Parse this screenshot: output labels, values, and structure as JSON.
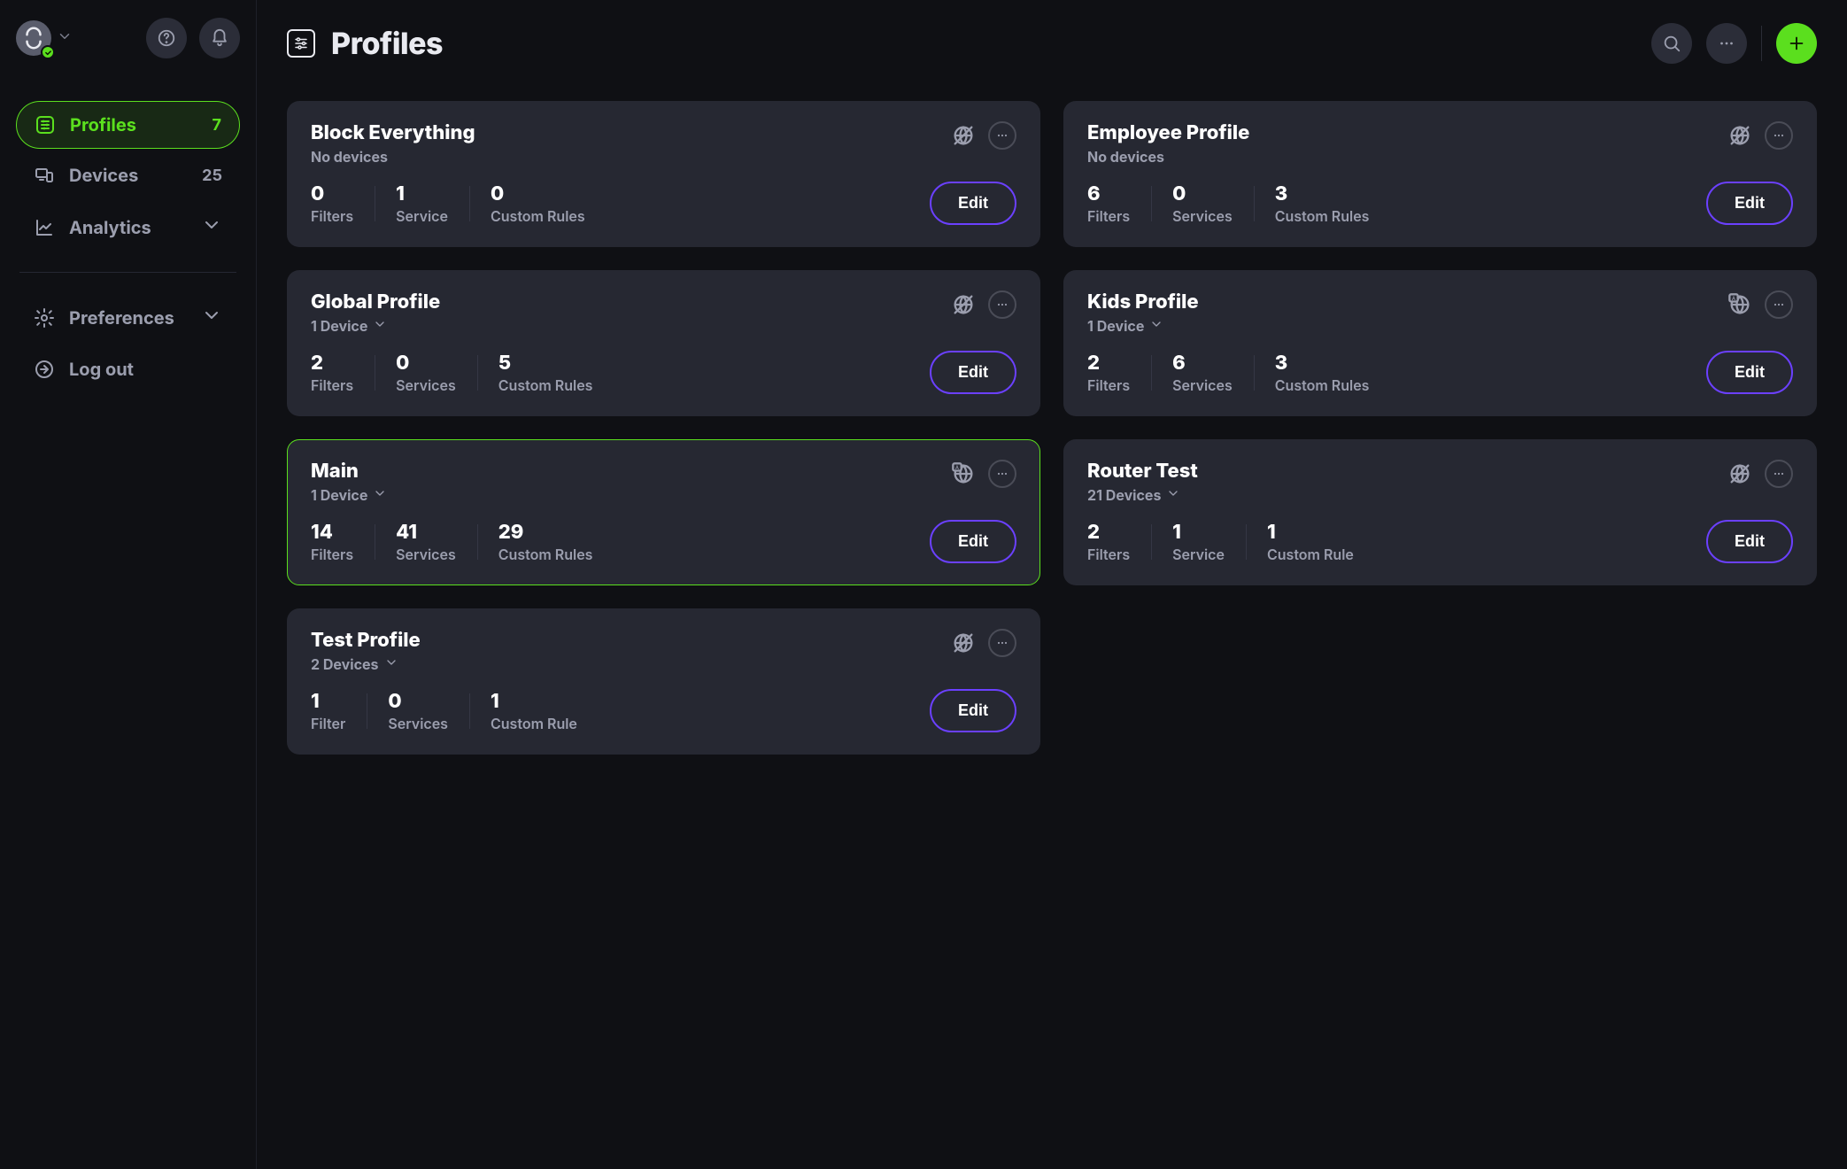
{
  "page_title": "Profiles",
  "sidebar": {
    "items": [
      {
        "icon": "sliders",
        "label": "Profiles",
        "count": "7",
        "active": true
      },
      {
        "icon": "devices",
        "label": "Devices",
        "count": "25"
      },
      {
        "icon": "analytics",
        "label": "Analytics",
        "chevron": true
      },
      {
        "divider": true
      },
      {
        "icon": "gear",
        "label": "Preferences",
        "chevron": true
      },
      {
        "icon": "logout",
        "label": "Log out"
      }
    ]
  },
  "cards": [
    {
      "title": "Block Everything",
      "sub": "No devices",
      "globe": "off",
      "stats": [
        {
          "n": "0",
          "l": "Filters"
        },
        {
          "n": "1",
          "l": "Service"
        },
        {
          "n": "0",
          "l": "Custom Rules"
        }
      ],
      "edit": "Edit"
    },
    {
      "title": "Employee Profile",
      "sub": "No devices",
      "globe": "off",
      "stats": [
        {
          "n": "6",
          "l": "Filters"
        },
        {
          "n": "0",
          "l": "Services"
        },
        {
          "n": "3",
          "l": "Custom Rules"
        }
      ],
      "edit": "Edit"
    },
    {
      "title": "Global Profile",
      "sub": "1 Device",
      "chev": true,
      "globe": "off",
      "stats": [
        {
          "n": "2",
          "l": "Filters"
        },
        {
          "n": "0",
          "l": "Services"
        },
        {
          "n": "5",
          "l": "Custom Rules"
        }
      ],
      "edit": "Edit"
    },
    {
      "title": "Kids Profile",
      "sub": "1 Device",
      "chev": true,
      "globe": "on",
      "stats": [
        {
          "n": "2",
          "l": "Filters"
        },
        {
          "n": "6",
          "l": "Services"
        },
        {
          "n": "3",
          "l": "Custom Rules"
        }
      ],
      "edit": "Edit"
    },
    {
      "title": "Main",
      "sub": "1 Device",
      "chev": true,
      "globe": "on",
      "highlight": true,
      "stats": [
        {
          "n": "14",
          "l": "Filters"
        },
        {
          "n": "41",
          "l": "Services"
        },
        {
          "n": "29",
          "l": "Custom Rules"
        }
      ],
      "edit": "Edit"
    },
    {
      "title": "Router Test",
      "sub": "21 Devices",
      "chev": true,
      "globe": "off",
      "stats": [
        {
          "n": "2",
          "l": "Filters"
        },
        {
          "n": "1",
          "l": "Service"
        },
        {
          "n": "1",
          "l": "Custom Rule"
        }
      ],
      "edit": "Edit"
    },
    {
      "title": "Test Profile",
      "sub": "2 Devices",
      "chev": true,
      "globe": "off",
      "stats": [
        {
          "n": "1",
          "l": "Filter"
        },
        {
          "n": "0",
          "l": "Services"
        },
        {
          "n": "1",
          "l": "Custom Rule"
        }
      ],
      "edit": "Edit"
    }
  ]
}
